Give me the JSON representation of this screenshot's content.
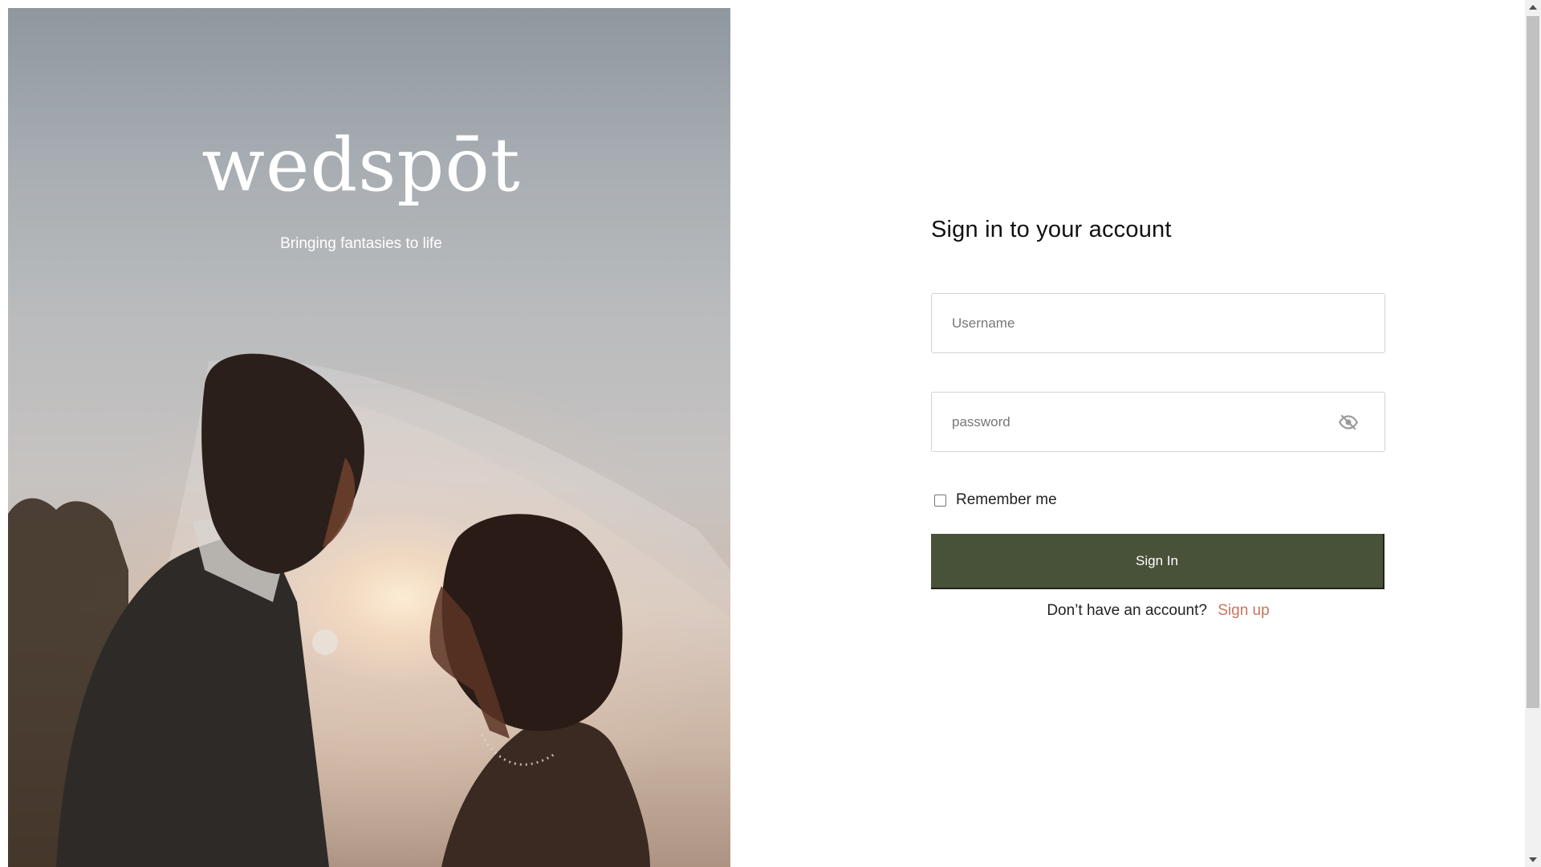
{
  "hero": {
    "brand": "wedspōt",
    "tagline": "Bringing fantasies to life"
  },
  "signin": {
    "title": "Sign in to your account",
    "username_placeholder": "Username",
    "password_placeholder": "password",
    "remember_label": "Remember me",
    "remember_checked": false,
    "submit_label": "Sign In",
    "no_account_text": "Don’t have an account?",
    "signup_label": "Sign up"
  },
  "colors": {
    "button": "#485239",
    "link": "#c8755c"
  },
  "icons": {
    "password_toggle": "eye-off-icon"
  }
}
